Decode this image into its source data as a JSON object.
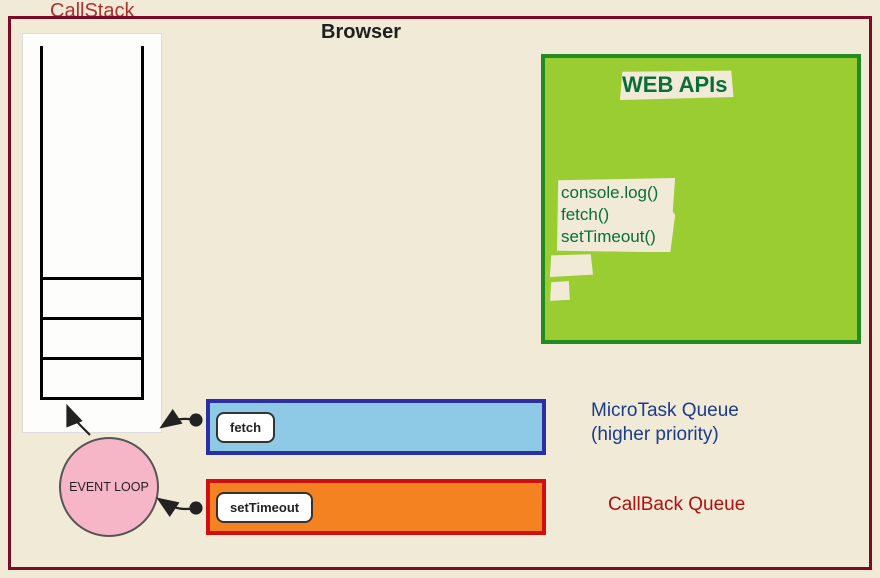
{
  "labels": {
    "callstack": "CallStack",
    "browser": "Browser",
    "webapis_title": "WEB APIs",
    "microtask_queue": "MicroTask Queue",
    "microtask_priority": "(higher priority)",
    "callback_queue": "CallBack Queue",
    "event_loop": "EVENT LOOP"
  },
  "webapis": {
    "items": [
      "console.log()",
      "fetch()",
      "setTimeout()"
    ]
  },
  "microtask_queue": {
    "items": [
      "fetch"
    ]
  },
  "callback_queue": {
    "items": [
      "setTimeout"
    ]
  },
  "callstack": {
    "slots": 4
  }
}
